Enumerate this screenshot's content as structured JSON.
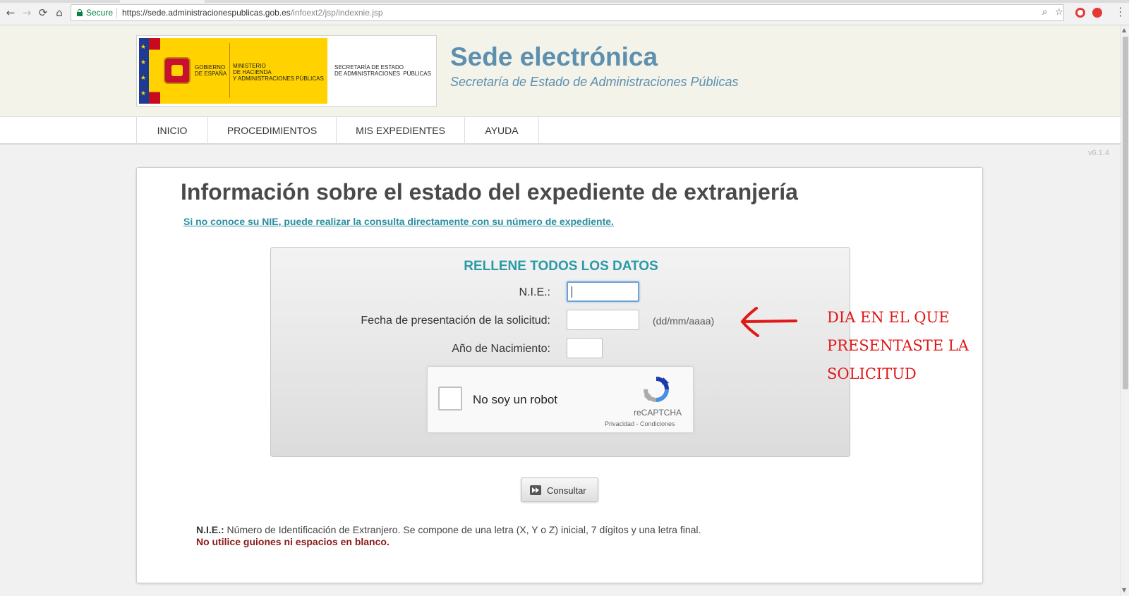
{
  "browser": {
    "secure_label": "Secure",
    "url_host": "https://sede.administracionespublicas.gob.es",
    "url_path": "/infoext2/jsp/indexnie.jsp",
    "icons": [
      "back-icon",
      "forward-icon",
      "reload-icon",
      "home-icon",
      "lock-icon",
      "zoom-icon",
      "star-icon",
      "menu-icon"
    ]
  },
  "logo": {
    "gobierno": "GOBIERNO\nDE ESPAÑA",
    "ministerio": "MINISTERIO\nDE HACIENDA\nY ADMINISTRACIONES PÚBLICAS",
    "secretaria": "SECRETARÍA DE ESTADO\nDE ADMINISTRACIONES  PÚBLICAS"
  },
  "header": {
    "title": "Sede electrónica",
    "subtitle": "Secretaría de Estado de Administraciones Públicas"
  },
  "nav": {
    "items": [
      {
        "label": "INICIO"
      },
      {
        "label": "PROCEDIMIENTOS"
      },
      {
        "label": "MIS EXPEDIENTES"
      },
      {
        "label": "AYUDA"
      }
    ]
  },
  "version": "v6.1.4",
  "main": {
    "title": "Información sobre el estado del expediente de extranjería",
    "link": "Si no conoce su NIE, puede realizar la consulta directamente con su número de expediente.",
    "form": {
      "heading": "RELLENE TODOS LOS DATOS",
      "nie_label": "N.I.E.:",
      "nie_value": "",
      "fecha_label": "Fecha de presentación de la solicitud:",
      "fecha_value": "",
      "fecha_hint": "(dd/mm/aaaa)",
      "anio_label": "Año de Nacimiento:",
      "anio_value": ""
    },
    "captcha": {
      "label": "No soy un robot",
      "brand": "reCAPTCHA",
      "links": "Privacidad - Condiciones"
    },
    "consultar_label": "Consultar",
    "footnote_term": "N.I.E.:",
    "footnote_text": " Número de Identificación de Extranjero. Se compone de una letra (X, Y o Z) inicial, 7 dígitos y una letra final.",
    "warning": "No utilice guiones ni espacios en blanco."
  },
  "annotation": {
    "lines": [
      "DIA EN EL QUE",
      "PRESENTASTE LA",
      "SOLICITUD"
    ],
    "color": "#e01818"
  },
  "colors": {
    "accent": "#2a9aa7",
    "header_title": "#5d8fae",
    "warning": "#8b1a1a"
  }
}
